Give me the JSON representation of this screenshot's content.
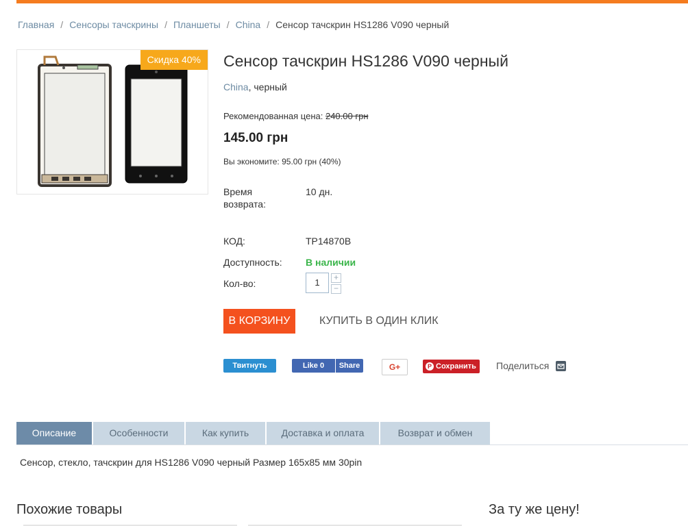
{
  "breadcrumb": {
    "items": [
      "Главная",
      "Сенсоры тачскрины",
      "Планшеты",
      "China"
    ],
    "current": "Сенсор тачскрин HS1286 V090 черный",
    "separator": "/"
  },
  "product": {
    "title": "Сенсор тачскрин HS1286 V090 черный",
    "brand": "China",
    "color_text": ", черный",
    "discount_badge": "Скидка 40%",
    "recommended_label": "Рекомендованная цена:",
    "recommended_price": "240.00 грн",
    "price": "145.00 грн",
    "savings": "Вы экономите: 95.00 грн (40%)",
    "return_label": "Время возврата:",
    "return_value": "10 дн.",
    "code_label": "КОД:",
    "code_value": "TP14870B",
    "availability_label": "Доступность:",
    "availability_value": "В наличии",
    "qty_label": "Кол-во:",
    "qty_value": "1",
    "qty_plus": "+",
    "qty_minus": "−"
  },
  "buttons": {
    "cart": "В КОРЗИНУ",
    "one_click": "КУПИТЬ В ОДИН КЛИК"
  },
  "social": {
    "twitter": "Твитнуть",
    "fb_like": "Like 0",
    "fb_share": "Share",
    "google": "G+",
    "pinterest": "Сохранить",
    "share": "Поделиться"
  },
  "tabs": [
    "Описание",
    "Особенности",
    "Как купить",
    "Доставка и оплата",
    "Возврат и обмен"
  ],
  "description": "Сенсор, стекло, тачскрин для HS1286 V090 черный Размер 165x85 мм 30pin",
  "sections": {
    "similar": "Похожие товары",
    "same_price": "За ту же цену!"
  },
  "colors": {
    "accent": "#f57c1f",
    "cart_button": "#f4511e",
    "badge": "#f7a81b",
    "in_stock": "#3ab54a",
    "active_tab": "#6d8ba8",
    "tab": "#c9d7e3"
  }
}
